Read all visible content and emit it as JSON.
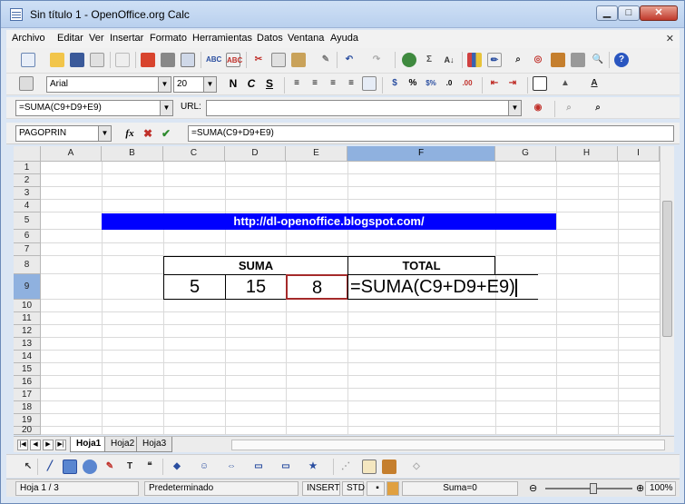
{
  "window": {
    "title": "Sin título 1 - OpenOffice.org Calc"
  },
  "menu": [
    "Archivo",
    "Editar",
    "Ver",
    "Insertar",
    "Formato",
    "Herramientas",
    "Datos",
    "Ventana",
    "Ayuda"
  ],
  "formatting": {
    "font_name": "Arial",
    "font_size": "20",
    "bold_label": "N",
    "italic_label": "C",
    "underline_label": "S"
  },
  "find_toolbar": {
    "formula_combo": "=SUMA(C9+D9+E9)",
    "url_label": "URL:"
  },
  "input_line": {
    "name_box": "PAGOPRIN",
    "function_wizard_label": "fx",
    "formula": "=SUMA(C9+D9+E9)"
  },
  "columns": [
    "A",
    "B",
    "C",
    "D",
    "E",
    "F",
    "G",
    "H",
    "I"
  ],
  "rows": [
    "1",
    "2",
    "3",
    "4",
    "5",
    "6",
    "7",
    "8",
    "9",
    "10",
    "11",
    "12",
    "13",
    "14",
    "15",
    "16",
    "17",
    "18",
    "19",
    "20"
  ],
  "selected": {
    "column": "F",
    "row": "9"
  },
  "cells": {
    "banner": "http://dl-openoffice.blogspot.com/",
    "suma_header": "SUMA",
    "total_header": "TOTAL",
    "c9": "5",
    "d9": "15",
    "e9": "8",
    "f9": "=SUMA(C9+D9+E9)"
  },
  "sheets": [
    "Hoja1",
    "Hoja2",
    "Hoja3"
  ],
  "active_sheet": "Hoja1",
  "status": {
    "sheet": "Hoja 1 / 3",
    "style": "Predeterminado",
    "mode": "INSERT",
    "selection": "STD",
    "sum": "Suma=0",
    "zoom": "100%",
    "zoom_level": 0.55
  },
  "colors": {
    "banner_bg": "#0000ff",
    "selected_header": "#8fb1df",
    "active_cell_border": "#a52a2a"
  }
}
